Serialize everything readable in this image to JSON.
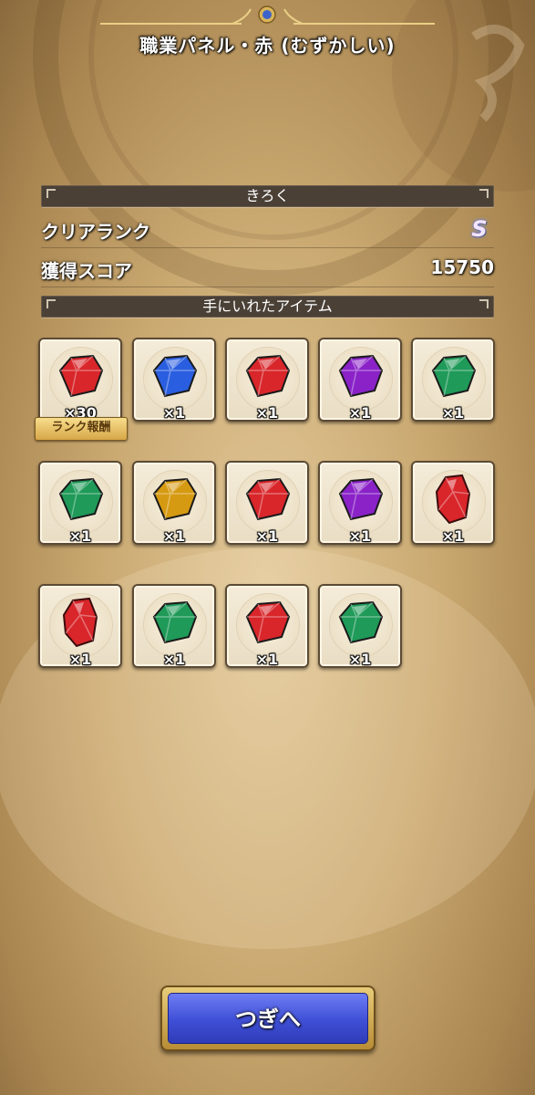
{
  "header": {
    "title": "職業パネル・赤 (むずかしい)"
  },
  "record": {
    "header": "きろく",
    "clear_rank_label": "クリアランク",
    "clear_rank_value": "S",
    "score_label": "獲得スコア",
    "score_value": "15750"
  },
  "items_section": {
    "header": "手にいれたアイテム",
    "rank_reward_badge": "ランク報酬",
    "items": [
      {
        "gem": "red-gem",
        "qty": "×30"
      },
      {
        "gem": "blue-gem",
        "qty": "×1"
      },
      {
        "gem": "red-gem",
        "qty": "×1"
      },
      {
        "gem": "purple-gem",
        "qty": "×1"
      },
      {
        "gem": "green-gem",
        "qty": "×1"
      },
      {
        "gem": "green-gem",
        "qty": "×1"
      },
      {
        "gem": "yellow-gem",
        "qty": "×1"
      },
      {
        "gem": "red-gem",
        "qty": "×1"
      },
      {
        "gem": "purple-gem",
        "qty": "×1"
      },
      {
        "gem": "red-crystal",
        "qty": "×1"
      },
      {
        "gem": "red-crystal",
        "qty": "×1"
      },
      {
        "gem": "green-gem",
        "qty": "×1"
      },
      {
        "gem": "red-gem",
        "qty": "×1"
      },
      {
        "gem": "green-gem",
        "qty": "×1"
      }
    ]
  },
  "next_button": {
    "label": "つぎへ"
  },
  "colors": {
    "red": "#d8262a",
    "blue": "#2a5ee0",
    "purple": "#8a22c8",
    "green": "#1f9a58",
    "yellow": "#d69a12",
    "button_blue": "#3f4fd6",
    "gold_frame": "#d7a748"
  }
}
